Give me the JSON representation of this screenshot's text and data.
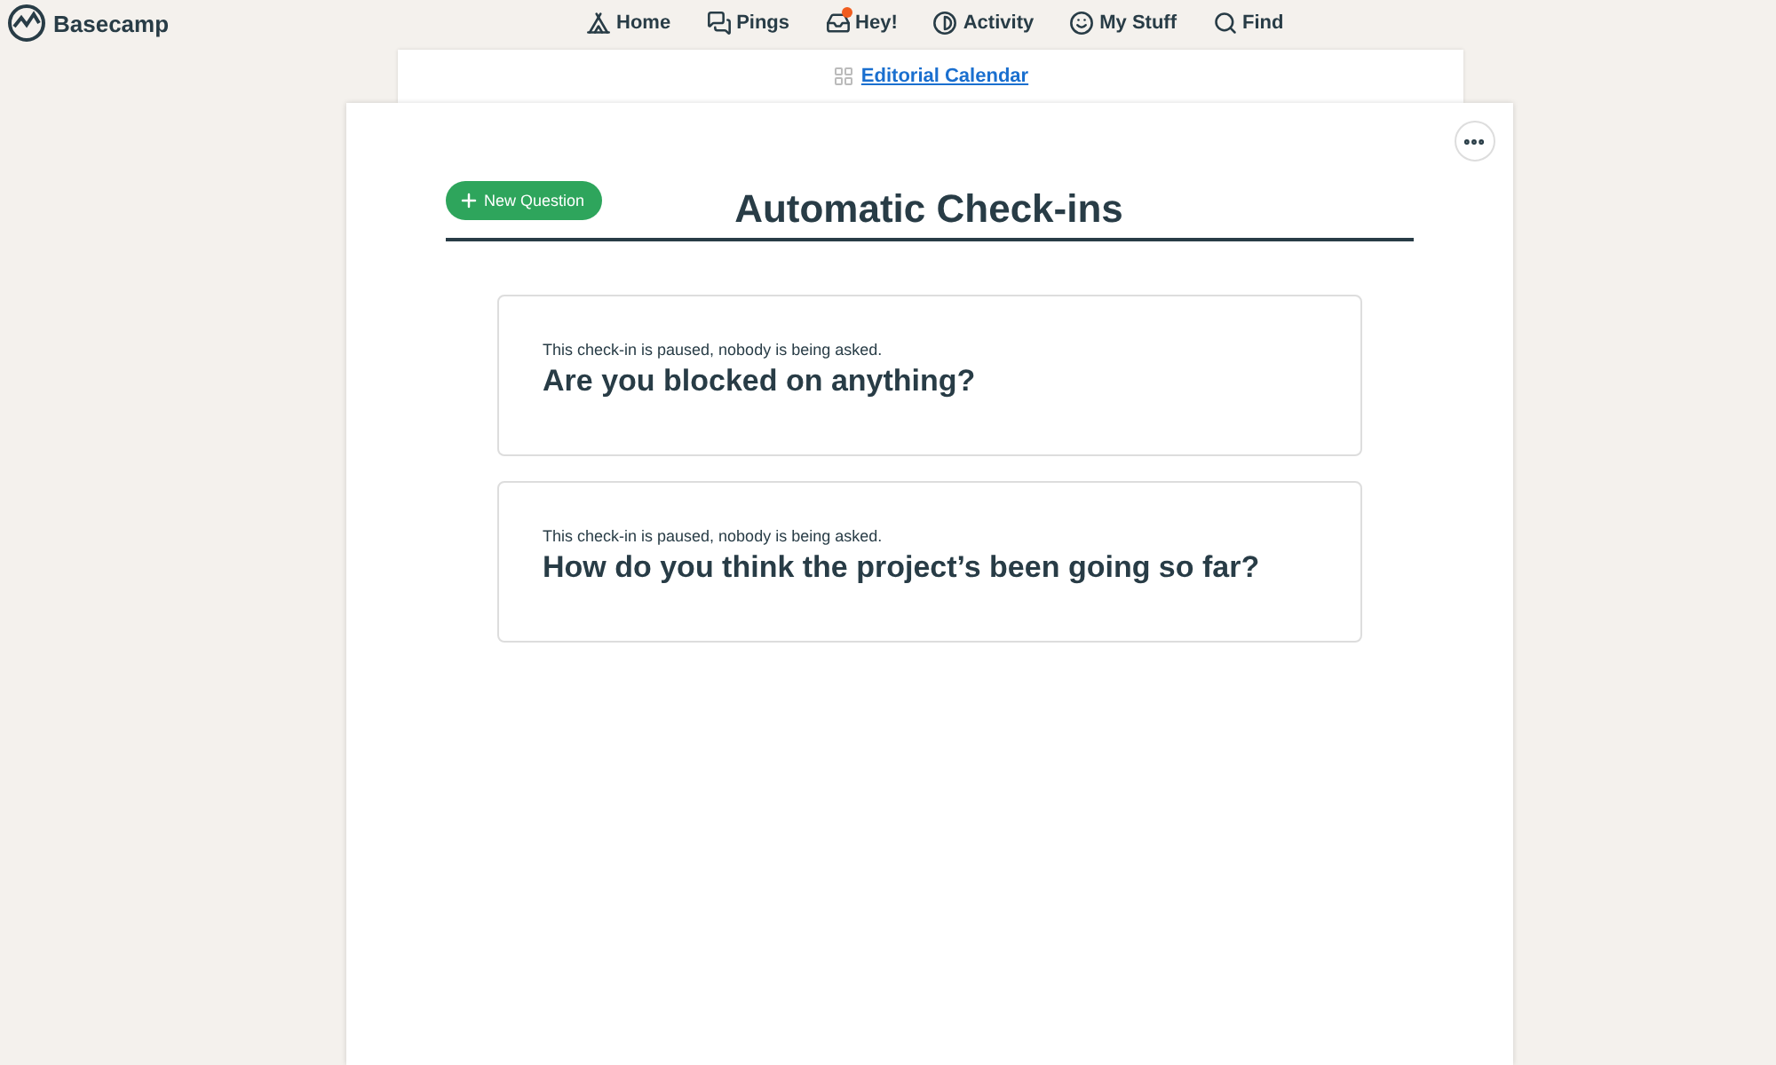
{
  "brand": {
    "name": "Basecamp"
  },
  "nav": [
    {
      "label": "Home",
      "kind": "home",
      "unread": false
    },
    {
      "label": "Pings",
      "kind": "pings",
      "unread": false
    },
    {
      "label": "Hey!",
      "kind": "hey",
      "unread": true
    },
    {
      "label": "Activity",
      "kind": "activity",
      "unread": false
    },
    {
      "label": "My Stuff",
      "kind": "mystuff",
      "unread": false
    },
    {
      "label": "Find",
      "kind": "find",
      "unread": false
    }
  ],
  "breadcrumb": {
    "label": "Editorial Calendar"
  },
  "page": {
    "title": "Automatic Check-ins",
    "new_button": "New Question"
  },
  "checkins": [
    {
      "status": "This check-in is paused, nobody is being asked.",
      "question": "Are you blocked on anything?"
    },
    {
      "status": "This check-in is paused, nobody is being asked.",
      "question": "How do you think the project’s been going so far?"
    }
  ]
}
